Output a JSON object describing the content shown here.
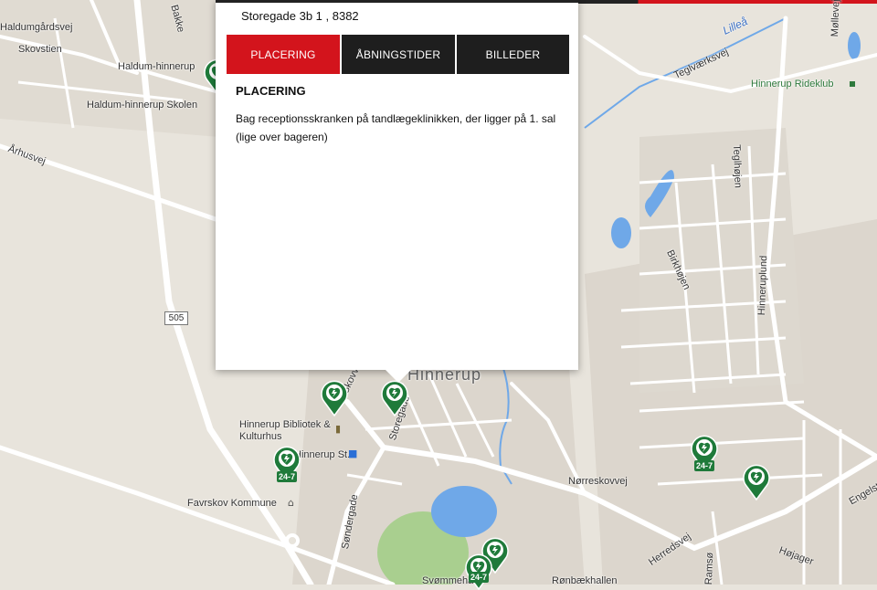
{
  "popup": {
    "address": "Storegade 3b 1 , 8382",
    "tabs": [
      {
        "label": "PLACERING",
        "active": true
      },
      {
        "label": "ÅBNINGSTIDER",
        "active": false
      },
      {
        "label": "BILLEDER",
        "active": false
      }
    ],
    "section_title": "PLACERING",
    "description": "Bag receptionsskranken på tandlægeklinikken, der ligger på 1. sal (lige over bageren)"
  },
  "map": {
    "labels": {
      "haldumgaardsvej": "Haldumgårdsvej",
      "skovstien": "Skovstien",
      "haldum_hinnerup": "Haldum-hinnerup",
      "haldum_skolen": "Haldum-hinnerup Skolen",
      "aarhusvej": "Århusvej",
      "road_505": "505",
      "hinnerup": "Hinnerup",
      "skovvej": "Skovvej",
      "storegade": "Storegade",
      "bibliotek": "Hinnerup Bibliotek & Kulturhus",
      "hinnerup_st": "Hinnerup St.",
      "favrskov": "Favrskov Kommune",
      "soendergade": "Søndergade",
      "svoemmehal": "Svømmehal",
      "raabaekhallen": "Rønbækhallen",
      "herredsvej": "Herredsvej",
      "noerreskovvej": "Nørreskovvej",
      "hoejager": "Højager",
      "engelst": "Engelst",
      "ramsoe": "Ramsø",
      "birkhoejen": "Birkhøjen",
      "hinneruplund": "Hinneruplund",
      "teglhoejen": "Teglhøjen",
      "teglvaerksvej": "Teglværksvej",
      "lillea": "Lilleå",
      "moellevej": "Møllevej",
      "rideklub": "Hinnerup Rideklub",
      "bakke": "Bakke"
    },
    "markers": [
      {
        "name": "aed-marker-skovvej",
        "badge": ""
      },
      {
        "name": "aed-marker-storegade",
        "badge": ""
      },
      {
        "name": "aed-marker-station",
        "badge": "24-7"
      },
      {
        "name": "aed-marker-haldum",
        "badge": ""
      },
      {
        "name": "aed-marker-noerreskovvej",
        "badge": "24-7"
      },
      {
        "name": "aed-marker-herredsvej",
        "badge": ""
      },
      {
        "name": "aed-marker-svoemmehal-1",
        "badge": ""
      },
      {
        "name": "aed-marker-svoemmehal-2",
        "badge": "24-7"
      }
    ],
    "colors": {
      "land": "#e8e4dc",
      "road": "#ffffff",
      "urban": "#dcd6cd",
      "water": "#6fa8e8",
      "park": "#a9cf8f",
      "marker": "#1f7a3a",
      "accent": "#d3141c"
    }
  }
}
